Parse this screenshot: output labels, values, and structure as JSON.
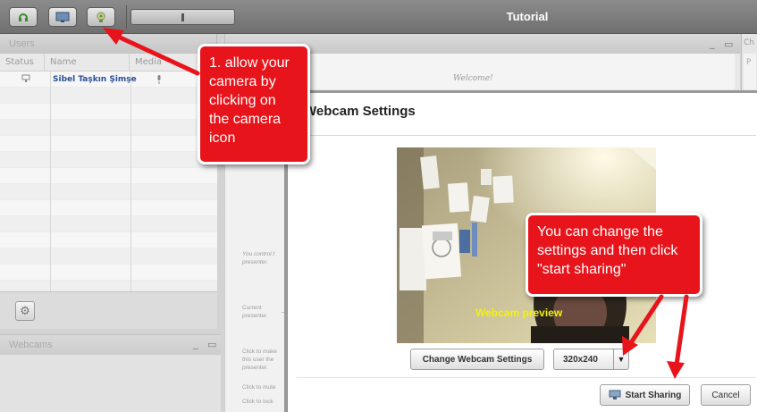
{
  "app": {
    "title": "Tutorial"
  },
  "toolbar": {
    "buttons": [
      "headset-icon",
      "desktop-share-icon",
      "webcam-icon"
    ]
  },
  "users_panel": {
    "title": "Users",
    "columns": [
      "Status",
      "Name",
      "Media"
    ],
    "rows": [
      {
        "status_icon": "presenter-icon",
        "name": "Sibel Taşkın Şimşe",
        "media_icon": "microphone-icon"
      }
    ],
    "settings_icon": "gear-icon"
  },
  "webcams_panel": {
    "title": "Webcams"
  },
  "presentation": {
    "welcome": "Welcome!"
  },
  "chat": {
    "tab": "Ch",
    "sub": "P"
  },
  "side": {
    "control_text": "You control t presenter.",
    "current_label": "Current presenter",
    "make_presenter": "Click to make this user the presenter.",
    "mute": "Click to mute",
    "lock": "Click to lock"
  },
  "dialog": {
    "title": "Webcam Settings",
    "preview_label": "Webcam preview",
    "change_button": "Change Webcam Settings",
    "resolution": "320x240",
    "start_button": "Start Sharing",
    "cancel_button": "Cancel"
  },
  "callouts": {
    "camera": "1. allow your camera by clicking on the camera icon",
    "settings": "You can change the settings and then click \"start sharing\""
  },
  "colors": {
    "callout": "#e8141b",
    "preview_label": "#f2f20a",
    "username": "#2a4f97"
  }
}
